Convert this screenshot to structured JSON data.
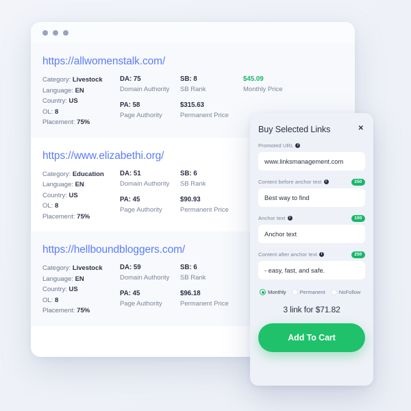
{
  "window": {
    "dots": [
      "dot-1",
      "dot-2",
      "dot-3"
    ]
  },
  "links": [
    {
      "url": "https://allwomenstalk.com/",
      "category_label": "Category:",
      "category_value": "Livestock",
      "language_label": "Language:",
      "language_value": "EN",
      "country_label": "Country:",
      "country_value": "US",
      "ol_label": "OL:",
      "ol_value": "8",
      "placement_label": "Placement:",
      "placement_value": "75%",
      "da_value": "DA: 75",
      "da_label": "Domain Authority",
      "pa_value": "PA: 58",
      "pa_label": "Page Authority",
      "sb_value": "SB: 8",
      "sb_label": "SB Rank",
      "permanent_price_value": "$315.63",
      "permanent_price_label": "Permanent Price",
      "monthly_price_value": "$45.09",
      "monthly_price_label": "Monthly Price"
    },
    {
      "url": "https://www.elizabethi.org/",
      "category_label": "Category:",
      "category_value": "Education",
      "language_label": "Language:",
      "language_value": "EN",
      "country_label": "Country:",
      "country_value": "US",
      "ol_label": "OL:",
      "ol_value": "8",
      "placement_label": "Placement:",
      "placement_value": "75%",
      "da_value": "DA: 51",
      "da_label": "Domain Authority",
      "pa_value": "PA: 45",
      "pa_label": "Page Authority",
      "sb_value": "SB: 6",
      "sb_label": "SB Rank",
      "permanent_price_value": "$90.93",
      "permanent_price_label": "Permanent Price",
      "monthly_price_value": "",
      "monthly_price_label": ""
    },
    {
      "url": "https://hellboundbloggers.com/",
      "category_label": "Category:",
      "category_value": "Livestock",
      "language_label": "Language:",
      "language_value": "EN",
      "country_label": "Country:",
      "country_value": "US",
      "ol_label": "OL:",
      "ol_value": "8",
      "placement_label": "Placement:",
      "placement_value": "75%",
      "da_value": "DA: 59",
      "da_label": "Domain Authority",
      "pa_value": "PA: 45",
      "pa_label": "Page Authority",
      "sb_value": "SB: 6",
      "sb_label": "SB Rank",
      "permanent_price_value": "$96.18",
      "permanent_price_label": "Permanent Price",
      "monthly_price_value": "",
      "monthly_price_label": ""
    }
  ],
  "modal": {
    "title": "Buy Selected Links",
    "close_label": "✕",
    "info_glyph": "i",
    "fields": [
      {
        "label": "Promoted URL",
        "value": "www.linksmanagement.com",
        "placeholder": "Promoted URL",
        "badge": ""
      },
      {
        "label": "Content before anchor text",
        "value": "Best way to find",
        "placeholder": "Content before anchor text",
        "badge": "250"
      },
      {
        "label": "Anchor text",
        "value": "Anchor text",
        "placeholder": "Anchor text",
        "badge": "100"
      },
      {
        "label": "Content after anchor text",
        "value": "- easy, fast, and safe.",
        "placeholder": "Content after anchor text",
        "badge": "250"
      }
    ],
    "radios": [
      {
        "label": "Monthly",
        "selected": true
      },
      {
        "label": "Permanent",
        "selected": false
      },
      {
        "label": "NoFollow",
        "selected": false
      }
    ],
    "summary": "3 link for $71.82",
    "cta_label": "Add To Cart"
  },
  "colors": {
    "accent_green": "#1fc16b",
    "badge_green": "#18b76b",
    "link_blue": "#5b7cfa",
    "text_dark": "#2c3145",
    "text_muted": "#7b8499",
    "page_bg": "#eef1f7",
    "checkbox_blue": "#cfdff0"
  }
}
